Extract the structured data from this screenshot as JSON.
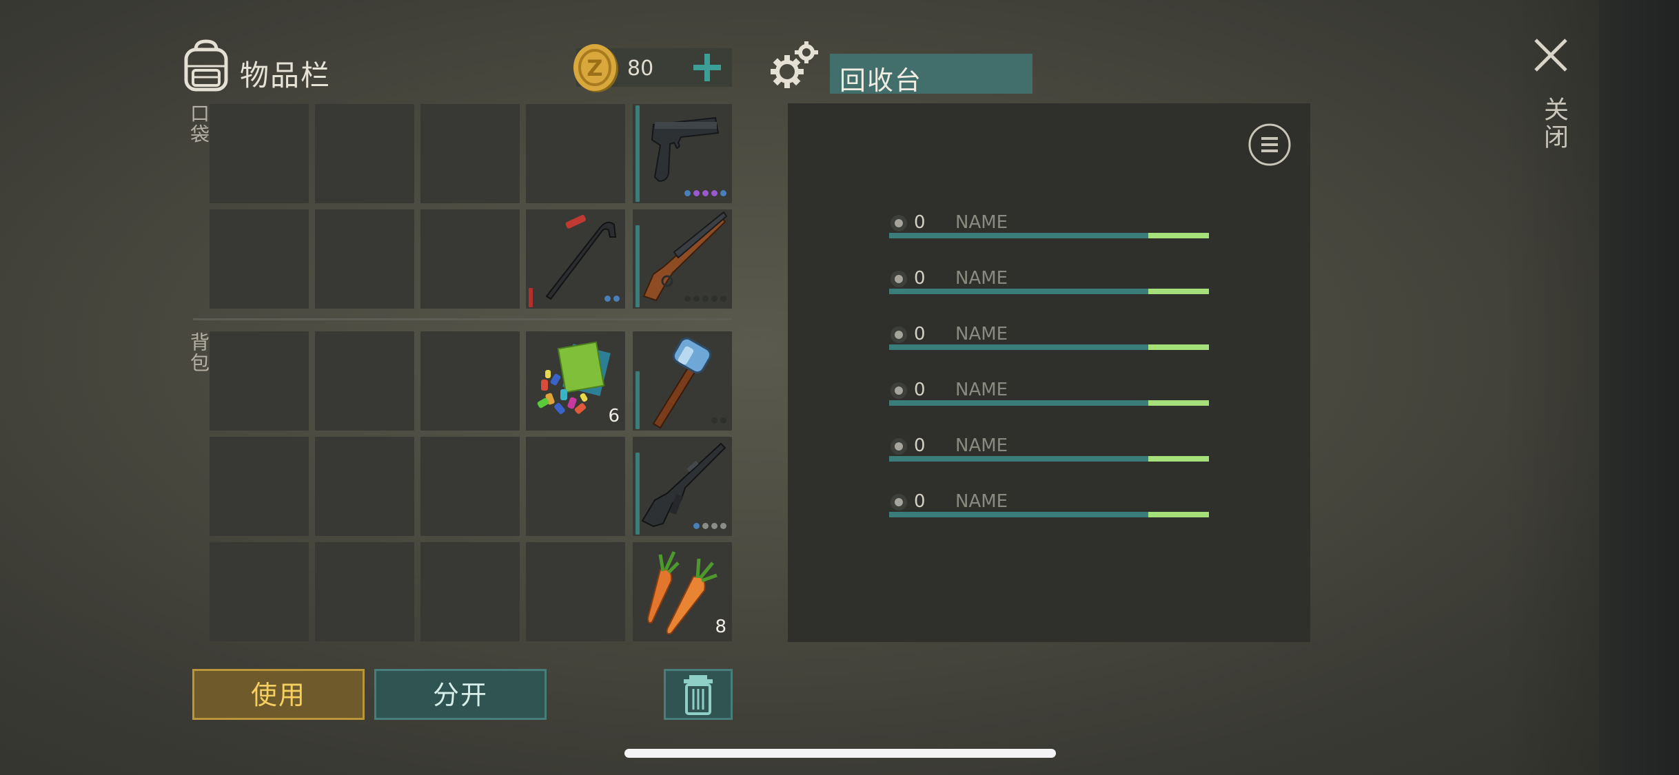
{
  "header": {
    "inventory_title": "物品栏",
    "coins": "80",
    "recycler_title": "回收台",
    "close_label": "关闭"
  },
  "side_labels": {
    "pocket": "口袋",
    "backpack": "背包"
  },
  "items": {
    "pistol": {
      "quality_dots": [
        "#4a7fb8",
        "#9b59d0",
        "#9b59d0",
        "#9b59d0",
        "#4a7fb8"
      ]
    },
    "crowbar": {
      "durability": 0.2,
      "durability_color": "#b3312c",
      "quality_dots": [
        "#4a7fb8",
        "#4a7fb8"
      ]
    },
    "shotgun": {
      "durability": 0.85,
      "durability_color": "#3a7d7b",
      "quality_dots": [
        "#2e302c",
        "#2e302c",
        "#2e302c",
        "#2e302c",
        "#2e302c"
      ]
    },
    "blueprints": {
      "count": "6"
    },
    "sledgehammer": {
      "durability": 0.6,
      "durability_color": "#3a7d7b",
      "quality_dots": [
        "#2e302c",
        "#2e302c"
      ]
    },
    "rifle": {
      "durability": 0.85,
      "durability_color": "#3a7d7b",
      "quality_dots": [
        "#4a7fb8",
        "#8a8d88",
        "#8a8d88",
        "#8a8d88"
      ]
    },
    "carrot": {
      "count": "8"
    }
  },
  "buttons": {
    "use": "使用",
    "split": "分开"
  },
  "recycle_rows": [
    {
      "amount": "0",
      "name": "NAME",
      "fill": 0.19
    },
    {
      "amount": "0",
      "name": "NAME",
      "fill": 0.19
    },
    {
      "amount": "0",
      "name": "NAME",
      "fill": 0.19
    },
    {
      "amount": "0",
      "name": "NAME",
      "fill": 0.19
    },
    {
      "amount": "0",
      "name": "NAME",
      "fill": 0.19
    },
    {
      "amount": "0",
      "name": "NAME",
      "fill": 0.19
    }
  ],
  "colors": {
    "accent_teal": "#426e6b",
    "progress_green": "#a6e07a",
    "use_gold": "#f5d060"
  }
}
